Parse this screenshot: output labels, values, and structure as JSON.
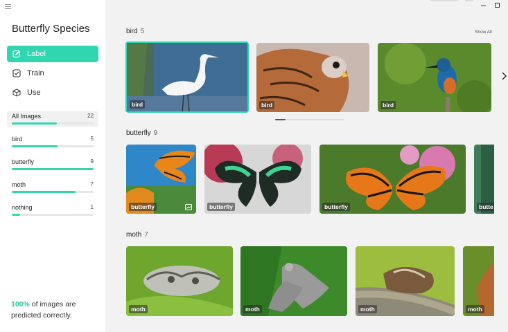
{
  "app": {
    "title": "Butterfly Species"
  },
  "nav": [
    {
      "label": "Label",
      "icon": "edit-icon",
      "active": true
    },
    {
      "label": "Train",
      "icon": "checkbox-icon",
      "active": false
    },
    {
      "label": "Use",
      "icon": "cube-icon",
      "active": false
    }
  ],
  "categories": [
    {
      "name": "All Images",
      "count": "22",
      "progress": 0.55
    },
    {
      "name": "bird",
      "count": "5",
      "progress": 0.56
    },
    {
      "name": "butterfly",
      "count": "9",
      "progress": 1.0
    },
    {
      "name": "moth",
      "count": "7",
      "progress": 0.78
    },
    {
      "name": "nothing",
      "count": "1",
      "progress": 0.1
    }
  ],
  "summary": {
    "percent": "100%",
    "text": " of images are predicted correctly."
  },
  "sections": [
    {
      "name": "bird",
      "count": "5",
      "show_all": "Show All",
      "tags": [
        "bird",
        "bird",
        "bird"
      ]
    },
    {
      "name": "butterfly",
      "count": "9",
      "tags": [
        "butterfly",
        "butterfly",
        "butterfly",
        "butte"
      ]
    },
    {
      "name": "moth",
      "count": "7",
      "tags": [
        "moth",
        "moth",
        "moth",
        "moth"
      ]
    }
  ],
  "colors": {
    "accent": "#2fd6b0",
    "sidebar_bg": "#ffffff",
    "content_bg": "#f2f2f2"
  }
}
